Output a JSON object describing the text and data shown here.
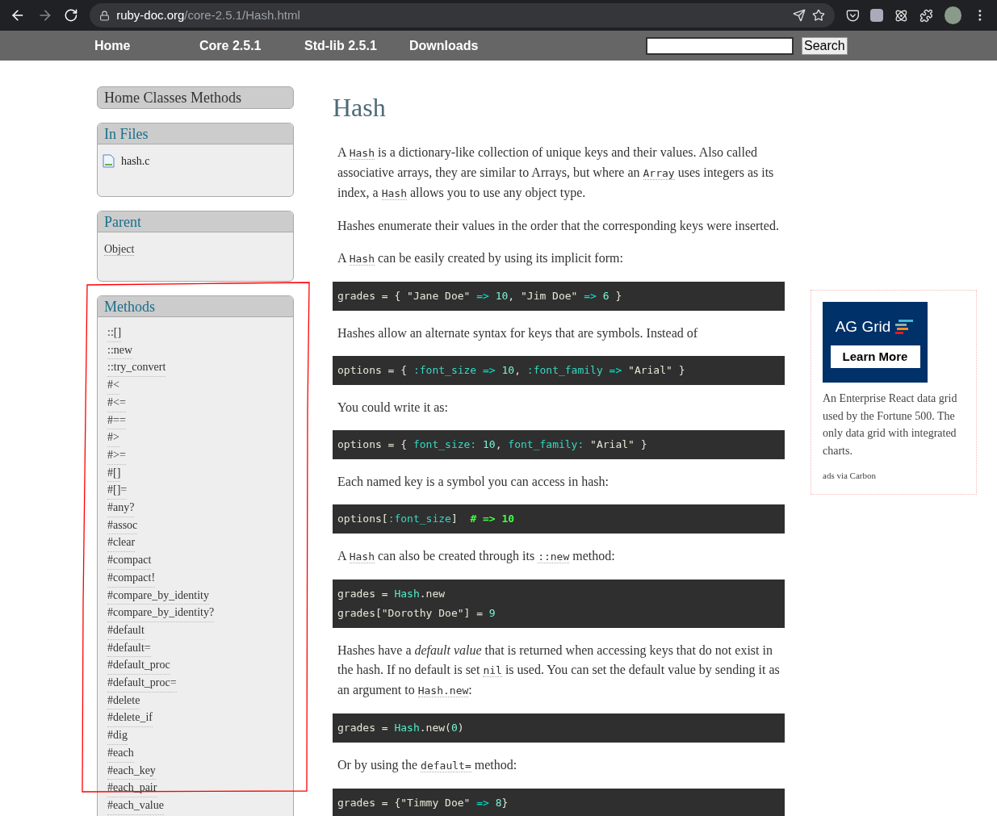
{
  "browser": {
    "url_host": "ruby-doc.org",
    "url_path": "/core-2.5.1/Hash.html"
  },
  "nav": {
    "links": [
      "Home",
      "Core 2.5.1",
      "Std-lib 2.5.1",
      "Downloads"
    ],
    "search_button": "Search"
  },
  "sidebar": {
    "top_links": "Home Classes Methods",
    "in_files": {
      "title": "In Files",
      "files": [
        "hash.c"
      ]
    },
    "parent": {
      "title": "Parent",
      "link": "Object"
    },
    "methods": {
      "title": "Methods",
      "items": [
        "::[]",
        "::new",
        "::try_convert",
        "#<",
        "#<=",
        "#==",
        "#>",
        "#>=",
        "#[]",
        "#[]=",
        "#any?",
        "#assoc",
        "#clear",
        "#compact",
        "#compact!",
        "#compare_by_identity",
        "#compare_by_identity?",
        "#default",
        "#default=",
        "#default_proc",
        "#default_proc=",
        "#delete",
        "#delete_if",
        "#dig",
        "#each",
        "#each_key",
        "#each_pair",
        "#each_value"
      ]
    }
  },
  "main": {
    "title": "Hash",
    "blocks": [
      {
        "kind": "para",
        "parts": [
          {
            "kind": "text",
            "text": "A "
          },
          {
            "kind": "code",
            "text": "Hash"
          },
          {
            "kind": "text",
            "text": " is a dictionary-like collection of unique keys and their values. Also called associative arrays, they are similar to Arrays, but where an "
          },
          {
            "kind": "code",
            "text": "Array"
          },
          {
            "kind": "text",
            "text": " uses integers as its index, a "
          },
          {
            "kind": "code",
            "text": "Hash"
          },
          {
            "kind": "text",
            "text": " allows you to use any object type."
          }
        ]
      },
      {
        "kind": "para",
        "parts": [
          {
            "kind": "text",
            "text": "Hashes enumerate their values in the order that the corresponding keys were inserted."
          }
        ]
      },
      {
        "kind": "para",
        "parts": [
          {
            "kind": "text",
            "text": "A "
          },
          {
            "kind": "code",
            "text": "Hash"
          },
          {
            "kind": "text",
            "text": " can be easily created by using its implicit form:"
          }
        ]
      },
      {
        "kind": "code",
        "lines": [
          [
            {
              "kind": "plain",
              "text": "grades = { \"Jane Doe\" "
            },
            {
              "kind": "op",
              "text": "=>"
            },
            {
              "kind": "num",
              "text": " 10"
            },
            {
              "kind": "plain",
              "text": ", \"Jim Doe\" "
            },
            {
              "kind": "op",
              "text": "=>"
            },
            {
              "kind": "num",
              "text": " 6"
            },
            {
              "kind": "plain",
              "text": " }"
            }
          ]
        ]
      },
      {
        "kind": "para",
        "parts": [
          {
            "kind": "text",
            "text": "Hashes allow an alternate syntax for keys that are symbols. Instead of"
          }
        ]
      },
      {
        "kind": "code",
        "lines": [
          [
            {
              "kind": "plain",
              "text": "options = { "
            },
            {
              "kind": "sym",
              "text": ":font_size"
            },
            {
              "kind": "op",
              "text": " =>"
            },
            {
              "kind": "num",
              "text": " 10"
            },
            {
              "kind": "plain",
              "text": ", "
            },
            {
              "kind": "sym",
              "text": ":font_family"
            },
            {
              "kind": "op",
              "text": " =>"
            },
            {
              "kind": "plain",
              "text": " \"Arial\" }"
            }
          ]
        ]
      },
      {
        "kind": "para",
        "parts": [
          {
            "kind": "text",
            "text": "You could write it as:"
          }
        ]
      },
      {
        "kind": "code",
        "lines": [
          [
            {
              "kind": "plain",
              "text": "options = { "
            },
            {
              "kind": "sym",
              "text": "font_size:"
            },
            {
              "kind": "num",
              "text": " 10"
            },
            {
              "kind": "plain",
              "text": ", "
            },
            {
              "kind": "sym",
              "text": "font_family:"
            },
            {
              "kind": "plain",
              "text": " \"Arial\" }"
            }
          ]
        ]
      },
      {
        "kind": "para",
        "parts": [
          {
            "kind": "text",
            "text": "Each named key is a symbol you can access in hash:"
          }
        ]
      },
      {
        "kind": "code",
        "lines": [
          [
            {
              "kind": "plain",
              "text": "options["
            },
            {
              "kind": "sym",
              "text": ":font_size"
            },
            {
              "kind": "plain",
              "text": "]  "
            },
            {
              "kind": "comment",
              "text": "# => 10"
            }
          ]
        ]
      },
      {
        "kind": "para",
        "parts": [
          {
            "kind": "text",
            "text": "A "
          },
          {
            "kind": "code",
            "text": "Hash"
          },
          {
            "kind": "text",
            "text": " can also be created through its "
          },
          {
            "kind": "code",
            "text": "::new"
          },
          {
            "kind": "text",
            "text": " method:"
          }
        ]
      },
      {
        "kind": "code",
        "lines": [
          [
            {
              "kind": "plain",
              "text": "grades = "
            },
            {
              "kind": "const",
              "text": "Hash"
            },
            {
              "kind": "plain",
              "text": ".new"
            }
          ],
          [
            {
              "kind": "plain",
              "text": "grades[\"Dorothy Doe\"] = "
            },
            {
              "kind": "num",
              "text": "9"
            }
          ]
        ]
      },
      {
        "kind": "para",
        "parts": [
          {
            "kind": "text",
            "text": "Hashes have a *default value* that is returned when accessing keys that do not exist in the hash. If no default is set "
          },
          {
            "kind": "code",
            "text": "nil"
          },
          {
            "kind": "text",
            "text": " is used. You can set the default value by sending it as an argument to "
          },
          {
            "kind": "code",
            "text": "Hash.new"
          },
          {
            "kind": "text",
            "text": ":"
          }
        ]
      },
      {
        "kind": "code",
        "lines": [
          [
            {
              "kind": "plain",
              "text": "grades = "
            },
            {
              "kind": "const",
              "text": "Hash"
            },
            {
              "kind": "plain",
              "text": ".new("
            },
            {
              "kind": "num",
              "text": "0"
            },
            {
              "kind": "plain",
              "text": ")"
            }
          ]
        ]
      },
      {
        "kind": "para",
        "parts": [
          {
            "kind": "text",
            "text": "Or by using the "
          },
          {
            "kind": "code",
            "text": "default="
          },
          {
            "kind": "text",
            "text": " method:"
          }
        ]
      },
      {
        "kind": "code",
        "lines": [
          [
            {
              "kind": "plain",
              "text": "grades = {\"Timmy Doe\" "
            },
            {
              "kind": "op",
              "text": "=>"
            },
            {
              "kind": "num",
              "text": " 8"
            },
            {
              "kind": "plain",
              "text": "}"
            }
          ]
        ]
      }
    ]
  },
  "ad": {
    "logo": "AG Grid",
    "cta": "Learn More",
    "text": "An Enterprise React data grid used by the Fortune 500. The only data grid with integrated charts.",
    "via": "ads via Carbon"
  }
}
